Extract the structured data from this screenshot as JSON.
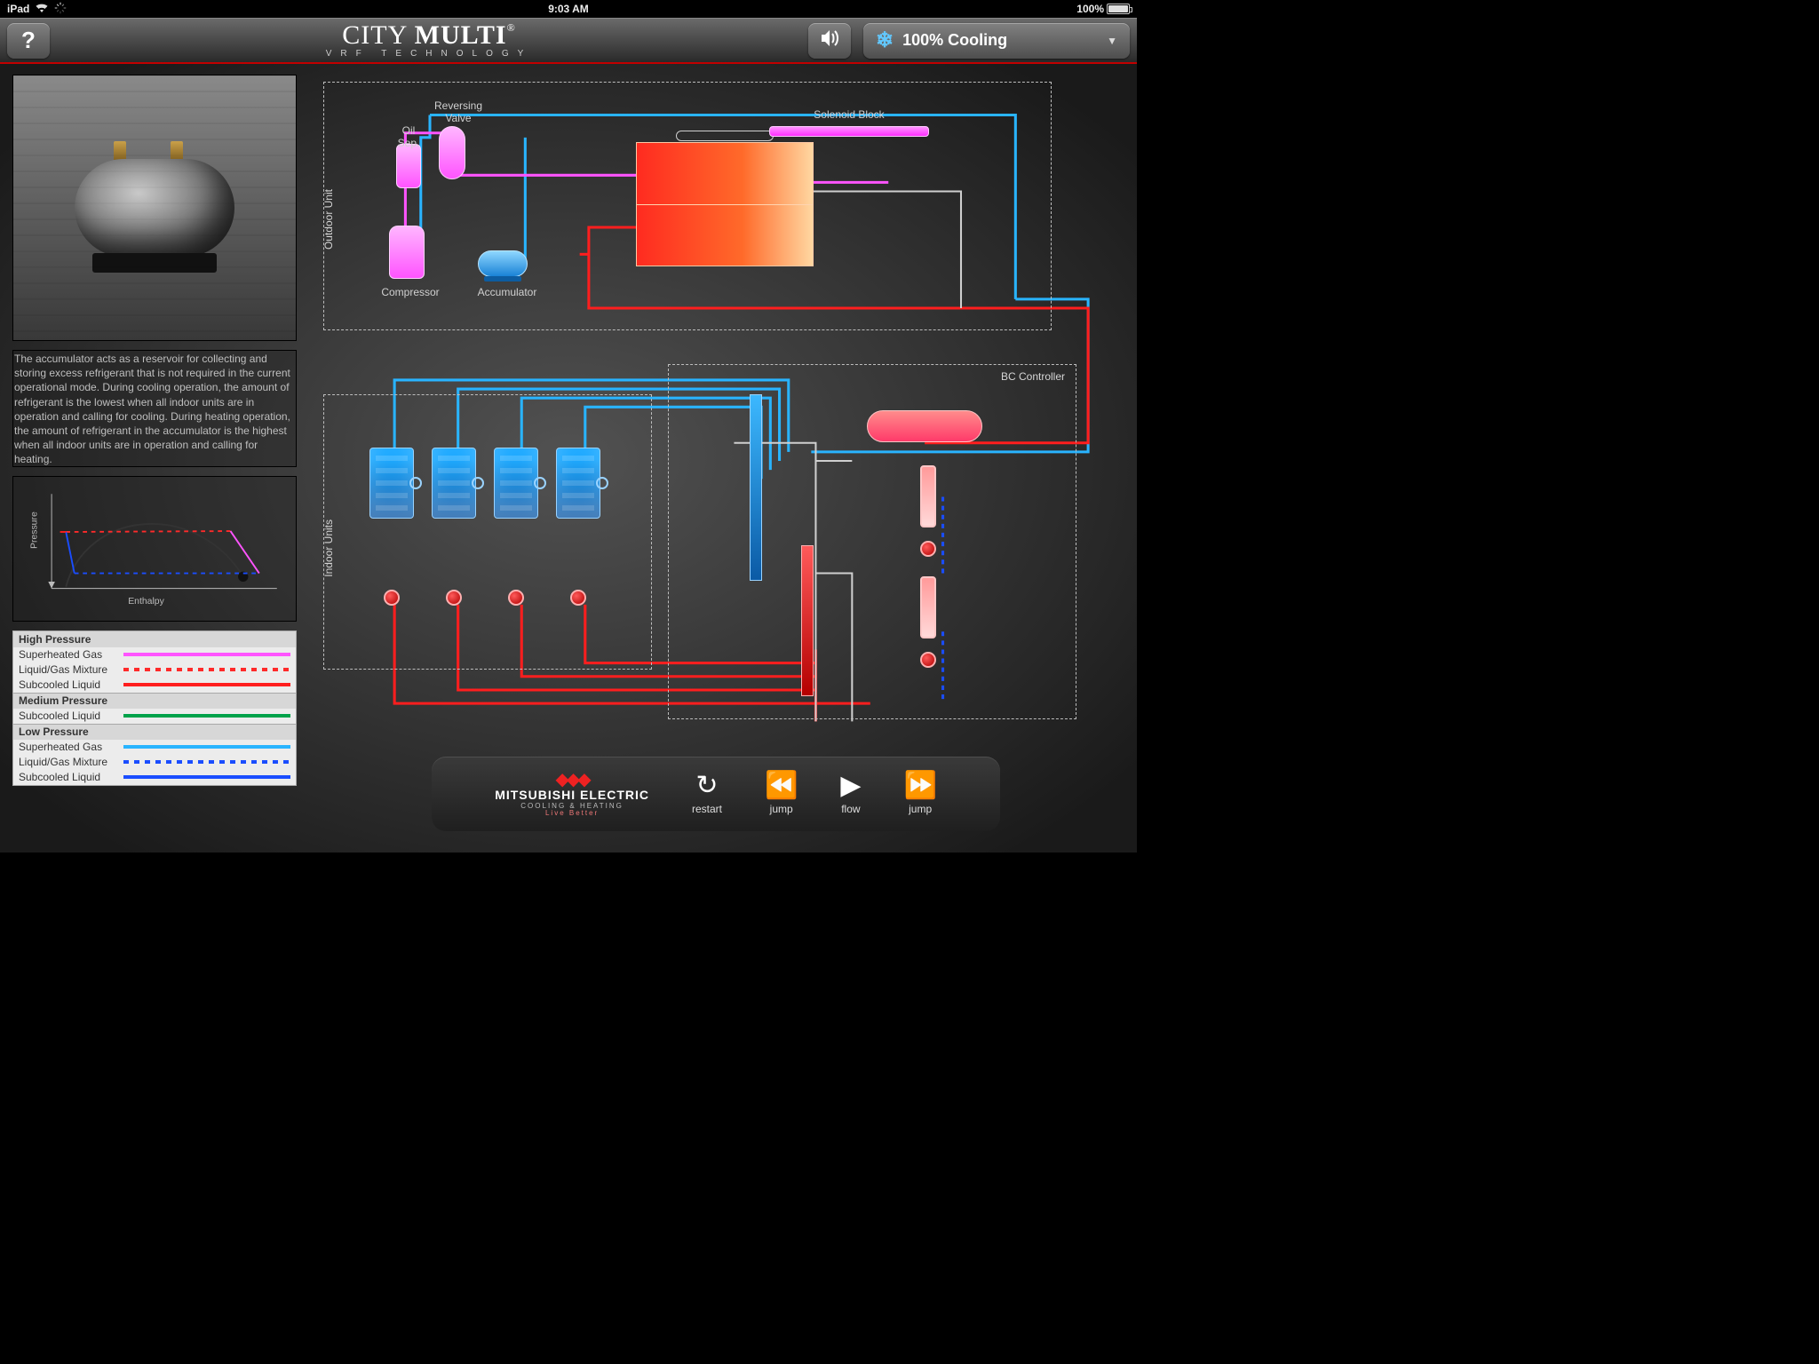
{
  "status": {
    "device": "iPad",
    "time": "9:03 AM",
    "battery_pct": "100%"
  },
  "header": {
    "brand_line1_a": "CITY",
    "brand_line1_b": "MULTI",
    "brand_reg": "®",
    "brand_line2": "VRF TECHNOLOGY",
    "help_glyph": "?",
    "mode_label": "100% Cooling"
  },
  "sidebar": {
    "description": "The accumulator acts as a reservoir for collecting and storing excess refrigerant that is not required in the current operational mode. During cooling operation, the amount of refrigerant is the lowest when all indoor units are in operation and calling for cooling. During heating operation, the amount of refrigerant in the accumulator is the highest when all indoor units are in operation and calling for heating.",
    "ph": {
      "xlabel": "Enthalpy",
      "ylabel": "Pressure"
    },
    "legend": {
      "hp_title": "High Pressure",
      "hp_rows": [
        "Superheated Gas",
        "Liquid/Gas Mixture",
        "Subcooled Liquid"
      ],
      "mp_title": "Medium Pressure",
      "mp_rows": [
        "Subcooled Liquid"
      ],
      "lp_title": "Low Pressure",
      "lp_rows": [
        "Superheated Gas",
        "Liquid/Gas Mixture",
        "Subcooled Liquid"
      ]
    }
  },
  "diagram": {
    "outdoor_label": "Outdoor Unit",
    "indoor_label": "Indoor Units",
    "bc_label": "BC Controller",
    "parts": {
      "oil_sep": "Oil\nSep.",
      "rev_valve": "Reversing\nValve",
      "compressor": "Compressor",
      "accumulator": "Accumulator",
      "solenoid_block": "Solenoid Block"
    }
  },
  "playback": {
    "brand1": "MITSUBISHI",
    "brand2": "ELECTRIC",
    "sub1": "COOLING & HEATING",
    "sub2": "Live Better",
    "restart": "restart",
    "jump1": "jump",
    "flow": "flow",
    "jump2": "jump"
  },
  "colors": {
    "cyan": "#29b4ff",
    "blue": "#1a4dff",
    "red": "#ff1e1e",
    "magenta": "#ff54ff",
    "gray": "#cfcfcf"
  }
}
